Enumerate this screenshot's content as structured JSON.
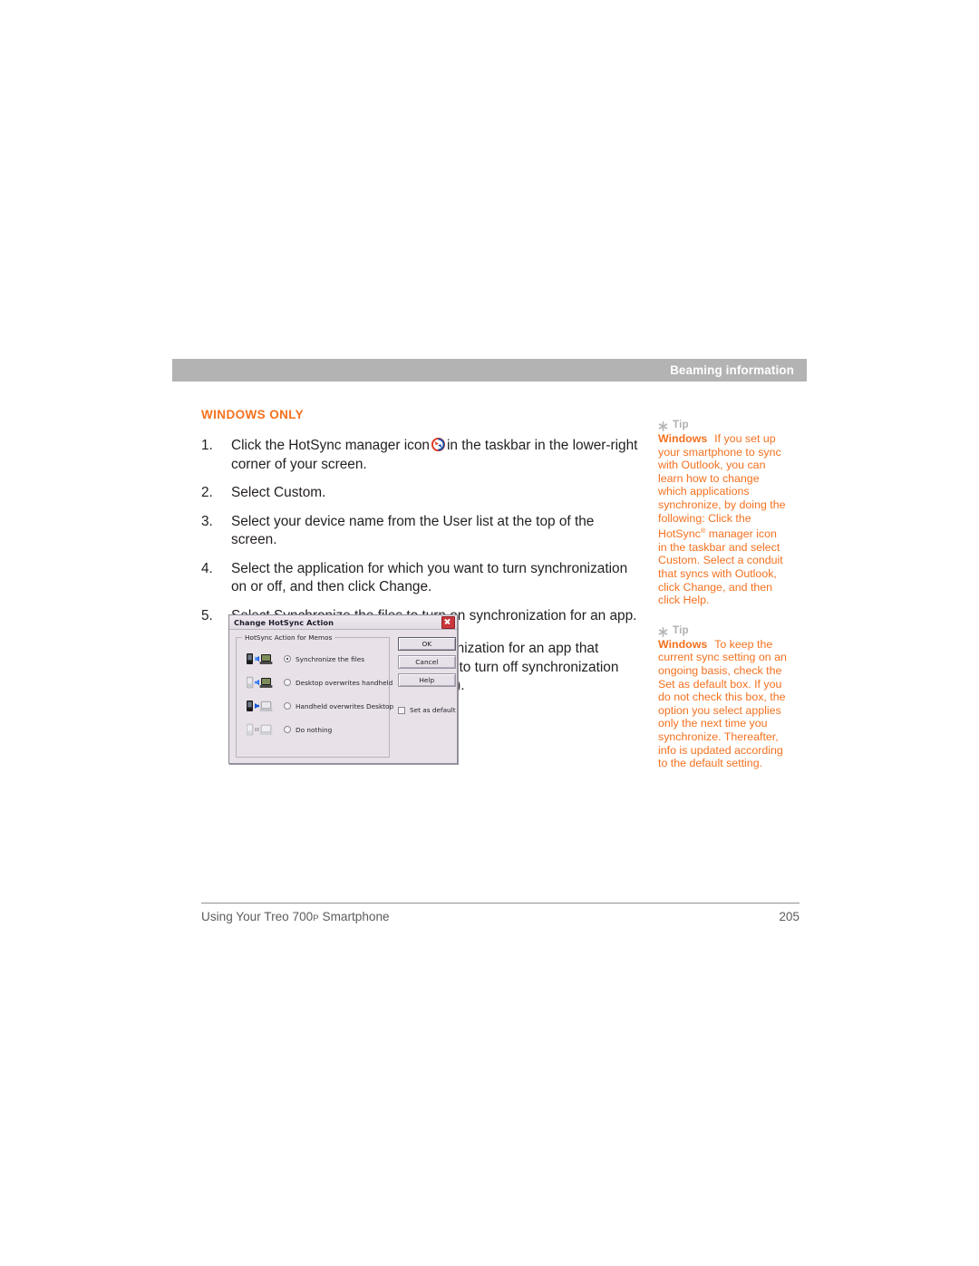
{
  "header": {
    "running_title": "Beaming information"
  },
  "main": {
    "section_heading": "WINDOWS ONLY",
    "steps": [
      {
        "num": "1.",
        "text_before_icon": "Click the HotSync manager icon",
        "icon": "hotsync-icon",
        "text_after_icon": "in the taskbar in the lower-right corner of your screen."
      },
      {
        "num": "2.",
        "text": "Select Custom."
      },
      {
        "num": "3.",
        "text": "Select your device name from the User list at the top of the screen."
      },
      {
        "num": "4.",
        "text": "Select the application for which you want to turn synchronization on or off, and then click Change."
      },
      {
        "num": "5.",
        "text": "Select Synchronize the files to turn on synchronization for an app."
      }
    ],
    "step5_continuation": "Select Do nothing to turn off synchronization for an app that currently synchronizes (for example, to turn off synchronization for Memos if you do not use this app)."
  },
  "dialog": {
    "title": "Change HotSync Action",
    "close_label": "close-icon",
    "groupbox_legend": "HotSync Action for Memos",
    "options": [
      {
        "label": "Synchronize the files",
        "selected": true,
        "icon": "two-way-sync-icon"
      },
      {
        "label": "Desktop overwrites handheld",
        "selected": false,
        "icon": "desktop-to-handheld-icon"
      },
      {
        "label": "Handheld overwrites Desktop",
        "selected": false,
        "icon": "handheld-to-desktop-icon"
      },
      {
        "label": "Do nothing",
        "selected": false,
        "icon": "no-sync-icon"
      }
    ],
    "buttons": [
      {
        "label": "OK",
        "default": true
      },
      {
        "label": "Cancel",
        "default": false
      },
      {
        "label": "Help",
        "default": false
      }
    ],
    "checkbox": {
      "label": "Set as default",
      "checked": false
    }
  },
  "tips": [
    {
      "label": "Tip",
      "lead": "Windows",
      "body": "If you set up your smartphone to sync with Outlook, you can learn how to change which applications synchronize, by doing the following: Click the HotSync",
      "body_after_reg": " manager icon in the taskbar and select Custom. Select a conduit that syncs with Outlook, click Change, and then click Help.",
      "has_registered_mark": true
    },
    {
      "label": "Tip",
      "lead": "Windows",
      "body": "To keep the current sync setting on an ongoing basis, check the Set as default box. If you do not check this box, the option you select applies only the next time you synchronize. Thereafter, info is updated according to the default setting.",
      "has_registered_mark": false
    }
  ],
  "footer": {
    "title_main": "Using Your Treo 700",
    "title_model": "P",
    "title_tail": " Smartphone",
    "page_number": "205"
  },
  "colors": {
    "accent_orange": "#f4711f",
    "header_band_gray": "#b3b3b3",
    "tip_label_gray": "#b0b0b0",
    "body_text": "#231f20",
    "footer_text": "#5d5d5d"
  }
}
